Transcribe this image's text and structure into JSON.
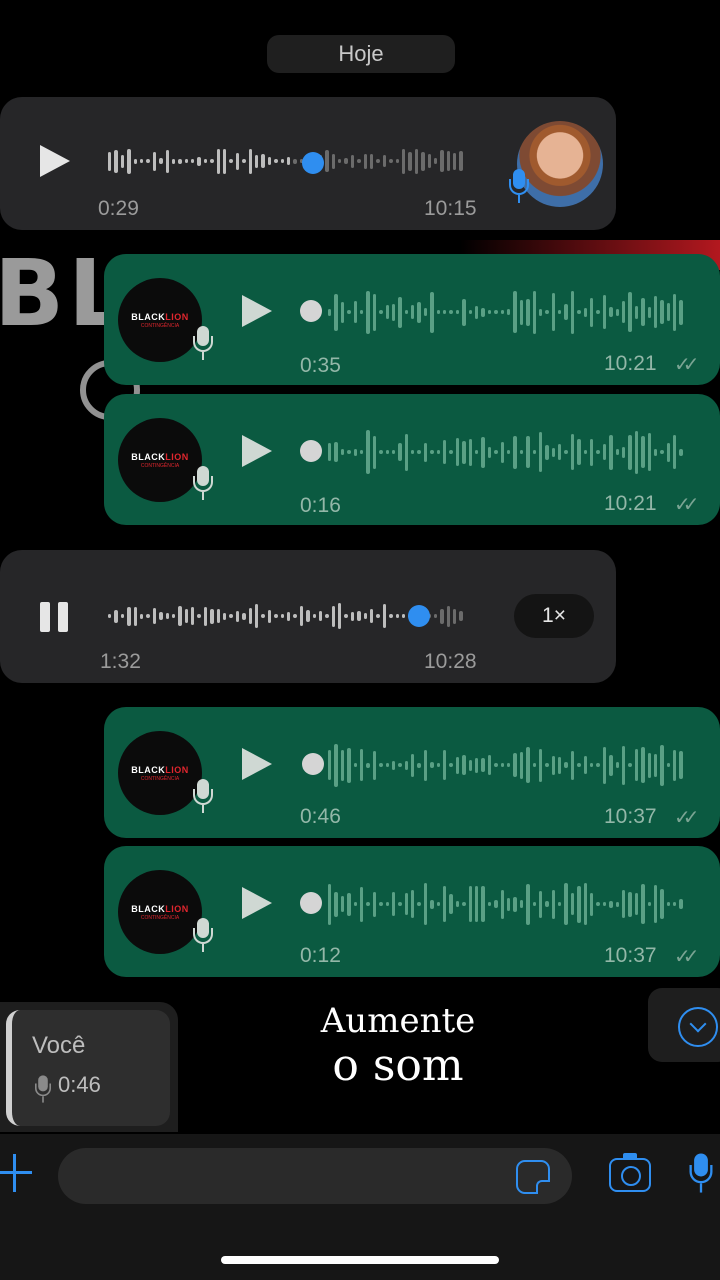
{
  "chat": {
    "date_label": "Hoje"
  },
  "messages": [
    {
      "direction": "incoming",
      "duration": "0:29",
      "time": "10:15",
      "state": "paused",
      "progress": 0.5
    },
    {
      "direction": "outgoing",
      "duration": "0:35",
      "time": "10:21",
      "read": true,
      "progress": 0
    },
    {
      "direction": "outgoing",
      "duration": "0:16",
      "time": "10:21",
      "read": true,
      "progress": 0
    },
    {
      "direction": "incoming",
      "duration": "1:32",
      "time": "10:28",
      "state": "playing",
      "progress": 0.84,
      "speed": "1×"
    },
    {
      "direction": "outgoing",
      "duration": "0:46",
      "time": "10:37",
      "read": true,
      "progress": 0
    },
    {
      "direction": "outgoing",
      "duration": "0:12",
      "time": "10:37",
      "read": true,
      "progress": 0
    }
  ],
  "read_ticks": "✓✓",
  "brand": {
    "logo_black": "BLACK",
    "logo_red": "LION",
    "logo_sub": "CONTINGÊNCIA",
    "banner_text": "BL"
  },
  "reply_preview": {
    "author": "Você",
    "duration": "0:46"
  },
  "overlay": {
    "line1": "Aumente",
    "line2": "o som"
  },
  "composer": {
    "placeholder": ""
  },
  "icons": {
    "attach": "plus-icon",
    "sticker": "sticker-icon",
    "camera": "camera-icon",
    "mic": "mic-icon",
    "scroll_down": "chevron-down-icon"
  },
  "colors": {
    "accent": "#2f8ef0",
    "outgoing_bubble": "#0b5a41",
    "incoming_bubble": "#262628",
    "brand_red": "#e0262e"
  }
}
